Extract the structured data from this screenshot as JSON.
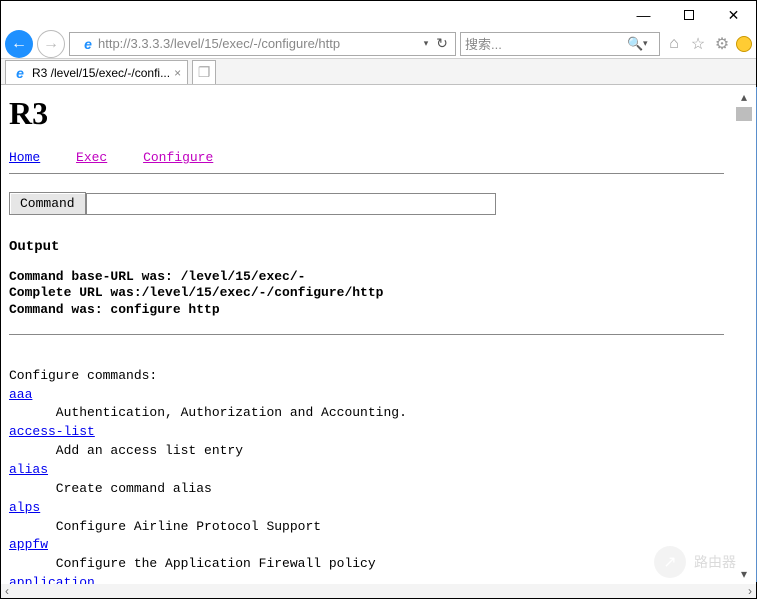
{
  "window": {
    "minimize": "—",
    "maximize": "",
    "close": "✕"
  },
  "nav": {
    "back": "←",
    "forward": "→",
    "url": "http://3.3.3.3/level/15/exec/-/configure/http",
    "dropdown": "▾",
    "refresh": "↻",
    "search_placeholder": "搜索...",
    "search_mag": "🔍",
    "search_dd": "▾",
    "home_icon": "⌂",
    "star_icon": "☆",
    "gear_icon": "⚙",
    "smiley": "ʘ‿ʘ"
  },
  "tab": {
    "title": "R3 /level/15/exec/-/confi...",
    "close": "×",
    "new": "+"
  },
  "page": {
    "title": "R3",
    "links": {
      "home": "Home",
      "exec": "Exec",
      "configure": "Configure"
    },
    "command_btn": "Command",
    "command_value": "",
    "output_header": "Output",
    "output_lines": [
      "Command base-URL was: /level/15/exec/-",
      "Complete URL was:/level/15/exec/-/configure/http",
      "Command was: configure http"
    ],
    "section_header": "Configure commands:",
    "commands": [
      {
        "name": "aaa",
        "desc": "Authentication, Authorization and Accounting."
      },
      {
        "name": "access-list",
        "desc": "Add an access list entry"
      },
      {
        "name": "alias",
        "desc": "Create command alias"
      },
      {
        "name": "alps",
        "desc": "Configure Airline Protocol Support"
      },
      {
        "name": "appfw",
        "desc": "Configure the Application Firewall policy"
      },
      {
        "name": "application",
        "desc": ""
      }
    ]
  },
  "watermark": {
    "icon": "↗",
    "text": "路由器"
  },
  "scroll": {
    "up": "▴",
    "down": "▾",
    "left": "‹",
    "right": "›"
  }
}
